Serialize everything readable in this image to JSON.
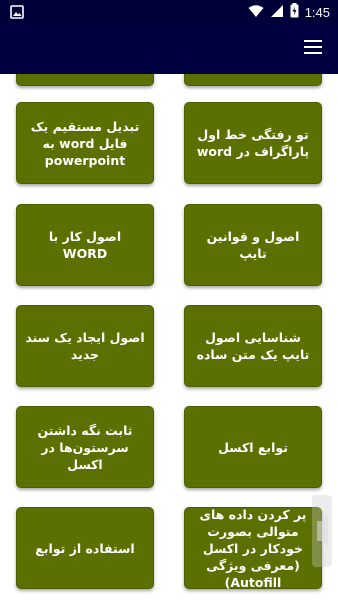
{
  "status_bar": {
    "time": "1:45",
    "icons": [
      "image-notification-icon",
      "wifi-icon",
      "cellular-signal-icon",
      "battery-icon"
    ]
  },
  "app_bar": {
    "menu_icon": "hamburger-menu-icon"
  },
  "colors": {
    "app_bar": "#000040",
    "card": "#5a7000",
    "card_text": "#ffffff"
  },
  "cards": [
    {
      "label": "تو رفتگی خط اول پاراگراف در word"
    },
    {
      "label": "تبدیل مستقیم یک فایل word  به powerpoint"
    },
    {
      "label": "اصول و قوانین تایپ"
    },
    {
      "label": "اصول کار با WORD"
    },
    {
      "label": "شناسایی اصول تایپ یک متن ساده"
    },
    {
      "label": "اصول ایجاد یک سند جدید"
    },
    {
      "label": "توابع اکسل"
    },
    {
      "label": "ثابت نگه داشتن سرستون‌ها در اکسل"
    },
    {
      "label": "پر کردن داده های متوالی بصورت خودکار در اکسل (معرفی ویژگی Autofill)"
    },
    {
      "label": "استفاده از توابع"
    }
  ]
}
